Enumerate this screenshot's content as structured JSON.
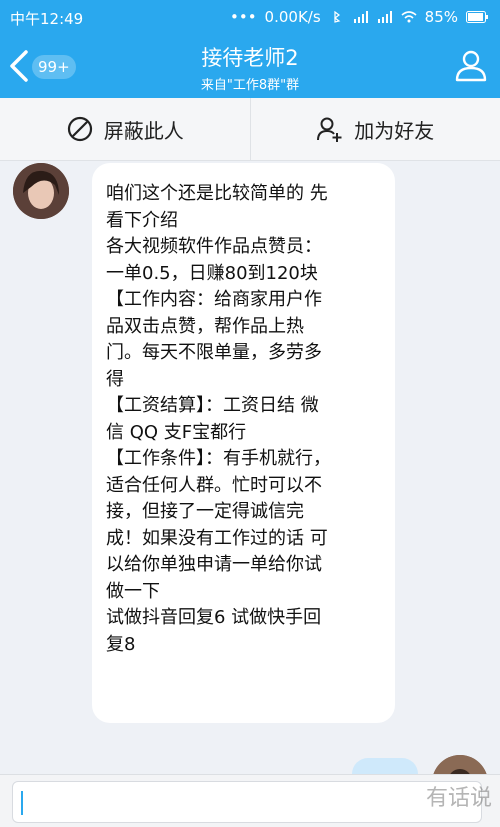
{
  "status_bar": {
    "time": "中午12:49",
    "network_speed": "0.00K/s",
    "battery": "85%"
  },
  "header": {
    "back_badge": "99+",
    "title": "接待老师2",
    "subtitle": "来自\"工作8群\"群"
  },
  "actions": {
    "block_label": "屏蔽此人",
    "add_friend_label": "加为好友"
  },
  "message": {
    "lines": [
      "咱们这个还是比较简单的 先",
      "看下介绍",
      "各大视频软件作品点赞员：",
      "一单0.5，日赚80到120块",
      "【工作内容：给商家用户作",
      "品双击点赞，帮作品上热",
      "门。每天不限单量，多劳多",
      "得",
      "【工资结算】：工资日结 微",
      "信 QQ 支F宝都行",
      "【工作条件】：有手机就行，",
      "适合任何人群。忙时可以不",
      "接，但接了一定得诚信完",
      "成！如果没有工作过的话 可",
      "以给你单独申请一单给你试",
      "做一下",
      "试做抖音回复6 试做快手回",
      "复8"
    ]
  },
  "input": {
    "placeholder": ""
  },
  "watermark": "有话说",
  "colors": {
    "header_blue": "#2aa8ee",
    "chat_bg": "#eef1f6"
  }
}
